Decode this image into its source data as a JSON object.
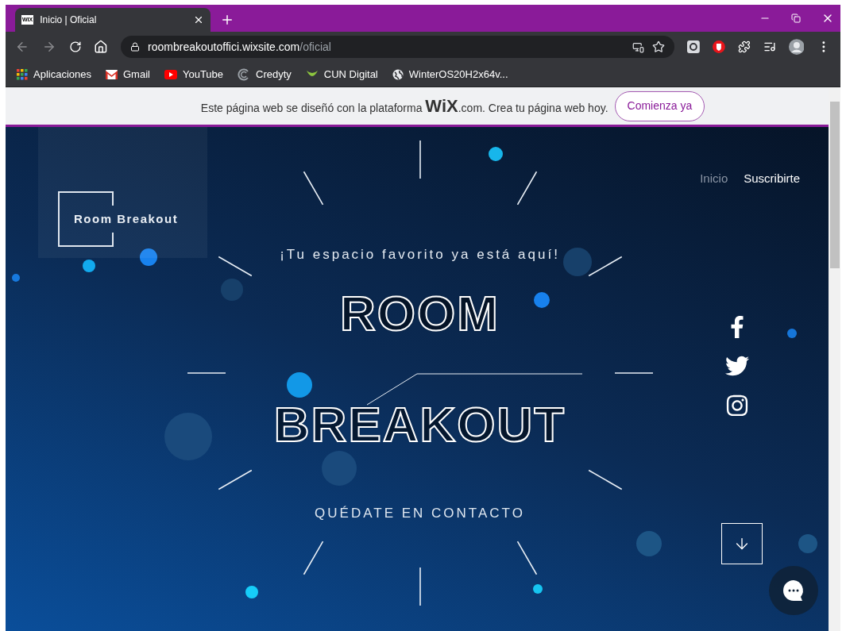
{
  "browser": {
    "tab": {
      "favicon": "WIX",
      "title": "Inicio | Oficial"
    },
    "address": {
      "host": "roombreakoutoffici.wixsite.com",
      "path": "/oficial"
    },
    "bookmarks": [
      {
        "kind": "apps",
        "label": "Aplicaciones"
      },
      {
        "kind": "gmail",
        "label": "Gmail"
      },
      {
        "kind": "youtube",
        "label": "YouTube"
      },
      {
        "kind": "credyty",
        "label": "Credyty"
      },
      {
        "kind": "cun",
        "label": "CUN Digital"
      },
      {
        "kind": "globe",
        "label": "WinterOS20H2x64v..."
      }
    ]
  },
  "wix_banner": {
    "text": "Este página web se diseñó con la plataforma **WiX**.com. Crea tu página web hoy.",
    "button": "Comienza ya"
  },
  "site": {
    "logo": "Room Breakout",
    "nav": [
      {
        "label": "Inicio",
        "selected": true
      },
      {
        "label": "Suscribirte",
        "selected": false
      }
    ],
    "tagline": "¡Tu espacio favorito ya está aquí!",
    "title_lines": [
      "ROOM",
      "BREAKOUT"
    ],
    "contact": "QUÉDATE EN CONTACTO",
    "social": [
      {
        "kind": "facebook"
      },
      {
        "kind": "twitter"
      },
      {
        "kind": "instagram"
      }
    ]
  }
}
